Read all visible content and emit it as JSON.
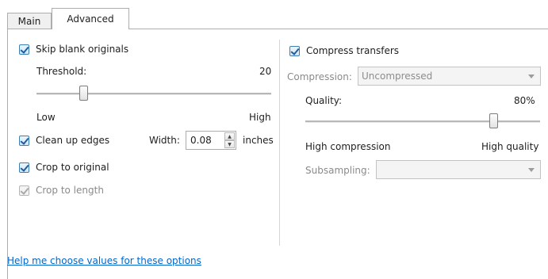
{
  "tabs": [
    {
      "label": "Main",
      "selected": false
    },
    {
      "label": "Advanced",
      "selected": true
    }
  ],
  "left": {
    "skip_blank": {
      "label": "Skip blank originals",
      "checked": true
    },
    "threshold": {
      "label": "Threshold:",
      "value": "20",
      "low": "Low",
      "high": "High",
      "position_fraction": 0.2
    },
    "clean_edges": {
      "label": "Clean up edges",
      "checked": true
    },
    "width": {
      "label": "Width:",
      "value": "0.08",
      "unit": "inches"
    },
    "crop_original": {
      "label": "Crop to original",
      "checked": true
    },
    "crop_length": {
      "label": "Crop to length",
      "checked": true,
      "disabled": true
    }
  },
  "right": {
    "compress": {
      "label": "Compress transfers",
      "checked": true
    },
    "compression": {
      "label": "Compression:",
      "value": "Uncompressed"
    },
    "quality": {
      "label": "Quality:",
      "value": "80%",
      "low": "High compression",
      "high": "High quality",
      "position_fraction": 0.8
    },
    "subsampling": {
      "label": "Subsampling:",
      "value": ""
    }
  },
  "help_link": "Help me choose values for these options",
  "icons": {
    "spin_up": "chevron-up-icon",
    "spin_down": "chevron-down-icon",
    "dropdown": "dropdown-arrow-icon"
  },
  "colors": {
    "accent": "#0066cc",
    "checkbox_border": "#3c7fb1"
  }
}
